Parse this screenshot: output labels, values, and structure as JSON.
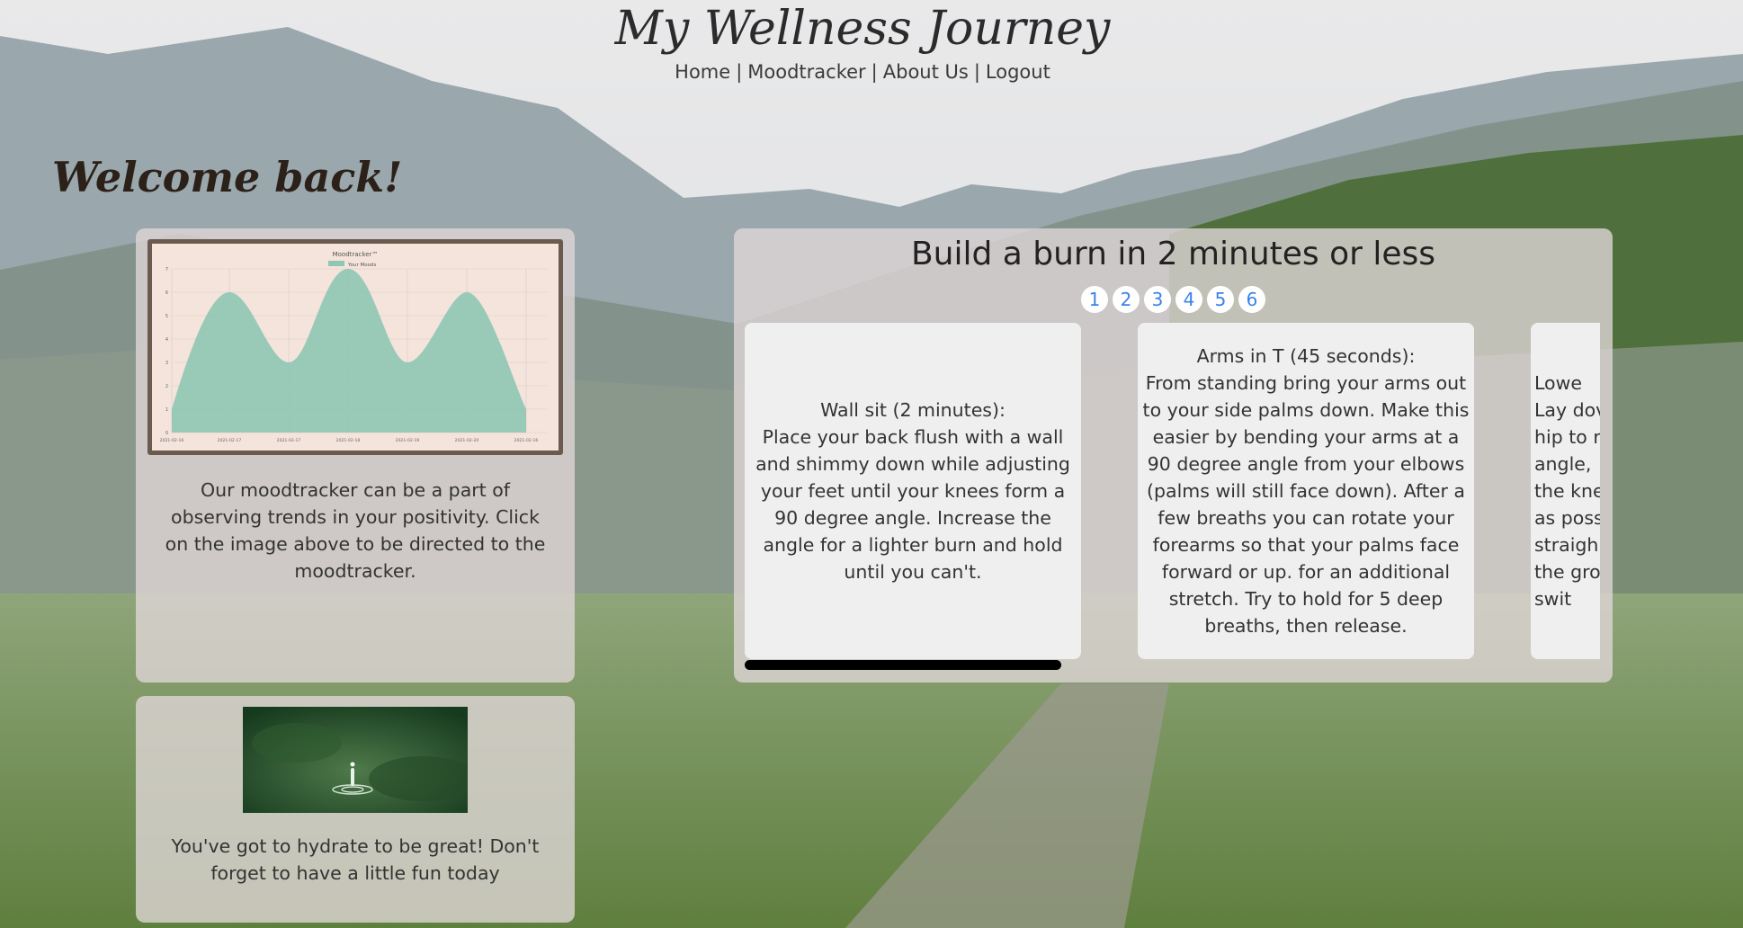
{
  "site": {
    "title": "My Wellness Journey",
    "nav": [
      "Home",
      "Moodtracker",
      "About Us",
      "Logout"
    ],
    "nav_separator": "|"
  },
  "welcome": "Welcome back!",
  "mood_card": {
    "image_label": "Moodtracker™",
    "legend_label": "Your Moods",
    "x_labels": [
      "2021-02-16",
      "2021-02-17",
      "2021-02-17",
      "2021-02-18",
      "2021-02-19",
      "2021-02-20",
      "2021-02-16"
    ],
    "y_labels": [
      "0",
      "1",
      "2",
      "3",
      "4",
      "5",
      "6",
      "7"
    ],
    "text": "Our moodtracker can be a part of observing trends in your positivity. Click on the image above to be directed to the moodtracker."
  },
  "hydrate_card": {
    "text": "You've got to hydrate to be great! Don't forget to have a little fun today"
  },
  "burn_card": {
    "title": "Build a burn in 2 minutes or less",
    "pages": [
      "1",
      "2",
      "3",
      "4",
      "5",
      "6"
    ],
    "slides": [
      {
        "heading": "Wall sit (2 minutes):",
        "body": "Place your back flush with a wall and shimmy down while adjusting your feet until your knees form a 90 degree angle. Increase the angle for a lighter burn and hold until you can't."
      },
      {
        "heading": "Arms in T (45 seconds):",
        "body": "From standing bring your arms out to your side palms down. Make this easier by bending your arms at a 90 degree angle from your elbows (palms will still face down). After a few breaths you can rotate your forearms so that your palms face forward or up. for an additional stretch. Try to hold for 5 deep breaths, then release."
      },
      {
        "heading": "Lowe",
        "lines": [
          "Lay dov",
          "hip to r",
          "angle,",
          "the kne",
          "as poss",
          "straigh",
          "the grou",
          "swit"
        ]
      }
    ]
  },
  "colors": {
    "accent_blue": "#3a82e8",
    "card_bg": "#dfd6d6",
    "chart_fill": "#8fc7b4"
  }
}
